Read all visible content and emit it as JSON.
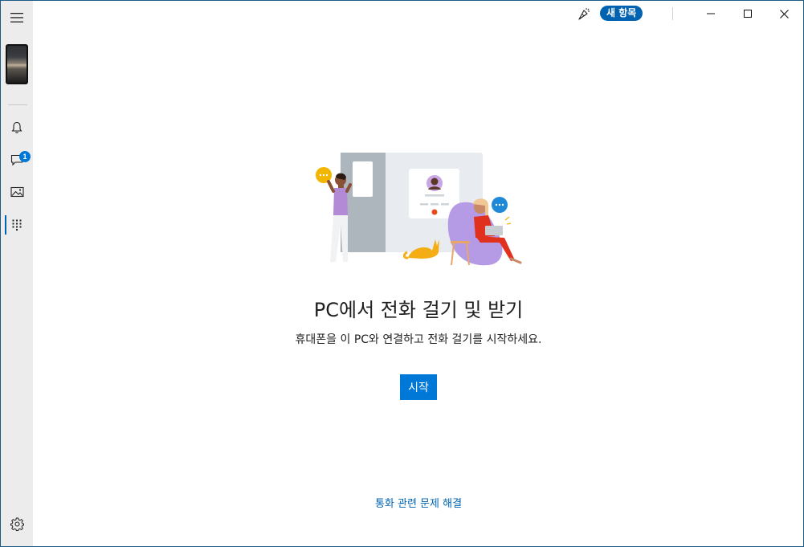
{
  "titlebar": {
    "whats_new_label": "새 항목",
    "icons": [
      "whats-new-icon",
      "minimize-icon",
      "maximize-icon",
      "close-icon"
    ]
  },
  "nav": {
    "items": [
      {
        "name": "menu",
        "icon": "hamburger-icon"
      },
      {
        "name": "phone-screen",
        "icon": "phone-thumbnail"
      },
      {
        "name": "notifications",
        "icon": "bell-icon"
      },
      {
        "name": "messages",
        "icon": "message-icon",
        "badge": "1"
      },
      {
        "name": "photos",
        "icon": "photo-icon"
      },
      {
        "name": "calls",
        "icon": "dialpad-icon",
        "active": true
      },
      {
        "name": "settings",
        "icon": "gear-icon"
      }
    ]
  },
  "main": {
    "title": "PC에서 전화 걸기 및 받기",
    "subtitle": "휴대폰을 이 PC와 연결하고 전화 걸기를 시작하세요.",
    "start_button": "시작",
    "troubleshoot_link": "통화 관련 문제 해결"
  },
  "colors": {
    "accent": "#0078d7",
    "link": "#0063b1",
    "rail_bg": "#ececec"
  }
}
